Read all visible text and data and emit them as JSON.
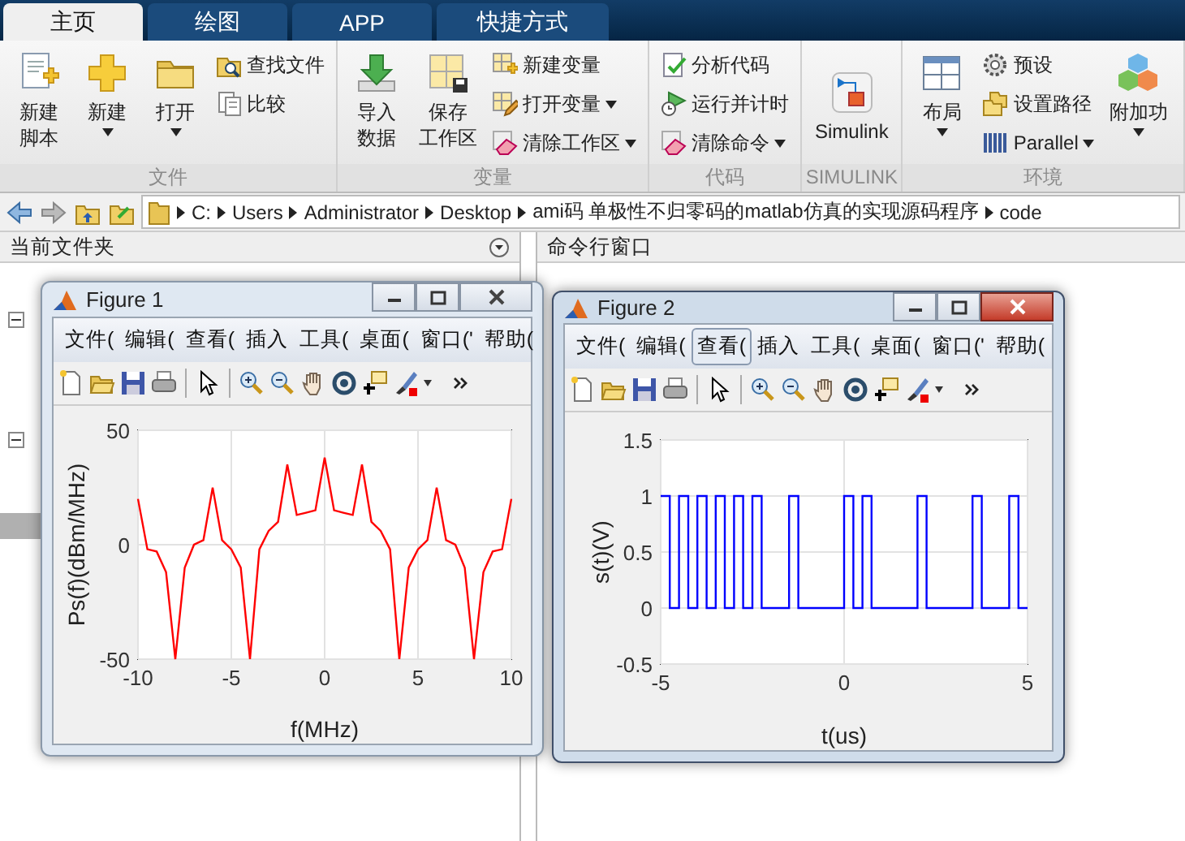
{
  "tabs": [
    {
      "label": "主页",
      "selected": true
    },
    {
      "label": "绘图",
      "selected": false
    },
    {
      "label": "APP",
      "selected": false
    },
    {
      "label": "快捷方式",
      "selected": false
    }
  ],
  "ribbon": {
    "groups": [
      {
        "title": "文件",
        "items": [
          {
            "kind": "large",
            "lines": [
              "新建",
              "脚本"
            ],
            "dropdown": false
          },
          {
            "kind": "large",
            "lines": [
              "新建"
            ],
            "dropdown": true
          },
          {
            "kind": "large",
            "lines": [
              "打开"
            ],
            "dropdown": true
          },
          {
            "kind": "stack",
            "entries": [
              {
                "label": "查找文件",
                "dropdown": false
              },
              {
                "label": "比较",
                "dropdown": false
              }
            ]
          }
        ]
      },
      {
        "title": "变量",
        "items": [
          {
            "kind": "large",
            "lines": [
              "导入",
              "数据"
            ],
            "dropdown": false
          },
          {
            "kind": "large",
            "lines": [
              "保存",
              "工作区"
            ],
            "dropdown": false
          },
          {
            "kind": "stack",
            "entries": [
              {
                "label": "新建变量",
                "dropdown": false
              },
              {
                "label": "打开变量",
                "dropdown": true
              },
              {
                "label": "清除工作区",
                "dropdown": true
              }
            ]
          }
        ]
      },
      {
        "title": "代码",
        "items": [
          {
            "kind": "stack",
            "entries": [
              {
                "label": "分析代码",
                "dropdown": false
              },
              {
                "label": "运行并计时",
                "dropdown": false
              },
              {
                "label": "清除命令",
                "dropdown": true
              }
            ]
          }
        ]
      },
      {
        "title": "SIMULINK",
        "items": [
          {
            "kind": "large",
            "lines": [
              "Simulink"
            ],
            "dropdown": false
          }
        ]
      },
      {
        "title": "环境",
        "items": [
          {
            "kind": "large",
            "lines": [
              "布局"
            ],
            "dropdown": true
          },
          {
            "kind": "stack",
            "entries": [
              {
                "label": "预设",
                "dropdown": false
              },
              {
                "label": "设置路径",
                "dropdown": false
              },
              {
                "label": "Parallel",
                "dropdown": true
              }
            ]
          },
          {
            "kind": "large",
            "lines": [
              "附加功"
            ],
            "dropdown": true
          }
        ]
      }
    ]
  },
  "address_bar": {
    "path": [
      "C:",
      "Users",
      "Administrator",
      "Desktop",
      "ami码 单极性不归零码的matlab仿真的实现源码程序",
      "code"
    ]
  },
  "panels": {
    "current_folder": {
      "title": "当前文件夹"
    },
    "command_window": {
      "title": "命令行窗口"
    }
  },
  "figures": [
    {
      "title": "Figure 1",
      "active": false,
      "menu": [
        {
          "label": "文件(",
          "highlighted": false
        },
        {
          "label": "编辑(",
          "highlighted": false
        },
        {
          "label": "查看(",
          "highlighted": false
        },
        {
          "label": "插入",
          "highlighted": false
        },
        {
          "label": "工具(",
          "highlighted": false
        },
        {
          "label": "桌面(",
          "highlighted": false
        },
        {
          "label": "窗口('",
          "highlighted": false
        },
        {
          "label": "帮助(",
          "highlighted": false
        }
      ],
      "chart_data": {
        "type": "line",
        "xlabel": "f(MHz)",
        "ylabel": "Ps(f)(dBm/MHz)",
        "x": [
          -10,
          -9.5,
          -9,
          -8.5,
          -8,
          -7.5,
          -7,
          -6.5,
          -6,
          -5.5,
          -5,
          -4.5,
          -4,
          -3.5,
          -3,
          -2.5,
          -2,
          -1.5,
          -1,
          -0.5,
          0,
          0.5,
          1,
          1.5,
          2,
          2.5,
          3,
          3.5,
          4,
          4.5,
          5,
          5.5,
          6,
          6.5,
          7,
          7.5,
          8,
          8.5,
          9,
          9.5,
          10
        ],
        "series": [
          {
            "color": "#ff0000",
            "values": [
              20,
              -2,
              -3,
              -12,
              -50,
              -10,
              0,
              2,
              25,
              2,
              -2,
              -10,
              -50,
              -2,
              6,
              10,
              35,
              13,
              14,
              15,
              38,
              15,
              14,
              13,
              35,
              10,
              6,
              -2,
              -50,
              -10,
              -2,
              2,
              25,
              2,
              0,
              -10,
              -50,
              -12,
              -3,
              -2,
              20
            ]
          }
        ],
        "xlim": [
          -10,
          10
        ],
        "ylim": [
          -50,
          50
        ],
        "grid": true,
        "xticks": [
          -10,
          -5,
          0,
          5,
          10
        ],
        "yticks": [
          -50,
          0,
          50
        ]
      }
    },
    {
      "title": "Figure 2",
      "active": true,
      "menu": [
        {
          "label": "文件(",
          "highlighted": false
        },
        {
          "label": "编辑(",
          "highlighted": false
        },
        {
          "label": "查看(",
          "highlighted": true
        },
        {
          "label": "插入",
          "highlighted": false
        },
        {
          "label": "工具(",
          "highlighted": false
        },
        {
          "label": "桌面(",
          "highlighted": false
        },
        {
          "label": "窗口('",
          "highlighted": false
        },
        {
          "label": "帮助(",
          "highlighted": false
        }
      ],
      "chart_data": {
        "type": "line",
        "xlabel": "t(us)",
        "ylabel": "s(t)(V)",
        "x": [
          -5,
          -4.75,
          -4.75,
          -4.5,
          -4.5,
          -4.25,
          -4.25,
          -4,
          -4,
          -3.75,
          -3.75,
          -3.5,
          -3.5,
          -3.25,
          -3.25,
          -3,
          -3,
          -2.75,
          -2.75,
          -2.5,
          -2.5,
          -2.25,
          -2.25,
          -1.5,
          -1.5,
          -1.25,
          -1.25,
          0,
          0,
          0.25,
          0.25,
          0.5,
          0.5,
          0.75,
          0.75,
          2,
          2,
          2.25,
          2.25,
          3.5,
          3.5,
          3.75,
          3.75,
          4.5,
          4.5,
          4.75,
          4.75,
          5
        ],
        "series": [
          {
            "color": "#0000ff",
            "values": [
              1,
              1,
              0,
              0,
              1,
              1,
              0,
              0,
              1,
              1,
              0,
              0,
              1,
              1,
              0,
              0,
              1,
              1,
              0,
              0,
              1,
              1,
              0,
              0,
              1,
              1,
              0,
              0,
              1,
              1,
              0,
              0,
              1,
              1,
              0,
              0,
              1,
              1,
              0,
              0,
              1,
              1,
              0,
              0,
              1,
              1,
              0,
              0
            ]
          }
        ],
        "xlim": [
          -5,
          5
        ],
        "ylim": [
          -0.5,
          1.5
        ],
        "grid": true,
        "xticks": [
          -5,
          0,
          5
        ],
        "yticks": [
          -0.5,
          0,
          0.5,
          1,
          1.5
        ]
      }
    }
  ]
}
